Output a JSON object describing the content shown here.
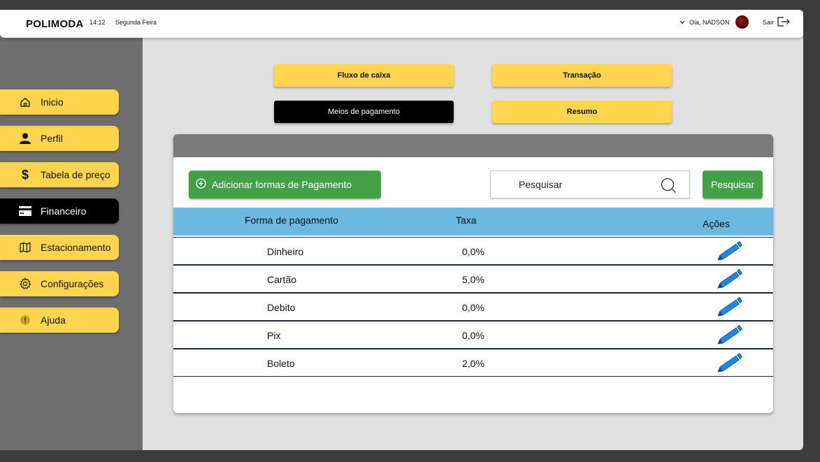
{
  "header": {
    "brand": "POLIMODA",
    "time": "14:12",
    "weekday": "Segunda Feira",
    "greeting": "Ola, NADSON",
    "logout_label": "Sair"
  },
  "sidebar": {
    "items": [
      {
        "label": "Inicio",
        "icon": "home-icon"
      },
      {
        "label": "Perfil",
        "icon": "person-icon"
      },
      {
        "label": "Tabela de preço",
        "icon": "dollar-icon"
      },
      {
        "label": "Financeiro",
        "icon": "card-icon",
        "active": true
      },
      {
        "label": "Estacionamento",
        "icon": "map-icon"
      },
      {
        "label": "Configurações",
        "icon": "gear-icon"
      },
      {
        "label": "Ajuda",
        "icon": "help-badge-icon"
      }
    ]
  },
  "tabs": {
    "fluxo": "Fluxo de caixa",
    "transacao": "Transação",
    "meios": "Meios de pagamento",
    "resumo": "Resumo"
  },
  "actions": {
    "add_label": "Adicionar formas de Pagamento",
    "search_placeholder": "Pesquisar",
    "search_button": "Pesquisar"
  },
  "table": {
    "headers": [
      "Forma de pagamento",
      "Taxa",
      "Ações"
    ],
    "rows": [
      {
        "forma": "Dinheiro",
        "taxa": "0,0%"
      },
      {
        "forma": "Cartão",
        "taxa": "5,0%"
      },
      {
        "forma": "Debito",
        "taxa": "0,0%"
      },
      {
        "forma": "Pix",
        "taxa": "0,0%"
      },
      {
        "forma": "Boleto",
        "taxa": "2,0%"
      }
    ]
  },
  "colors": {
    "accent_yellow": "#ffd54f",
    "green": "#43a047",
    "table_header": "#6bb8e0",
    "edit_blue": "#1e88e5"
  }
}
